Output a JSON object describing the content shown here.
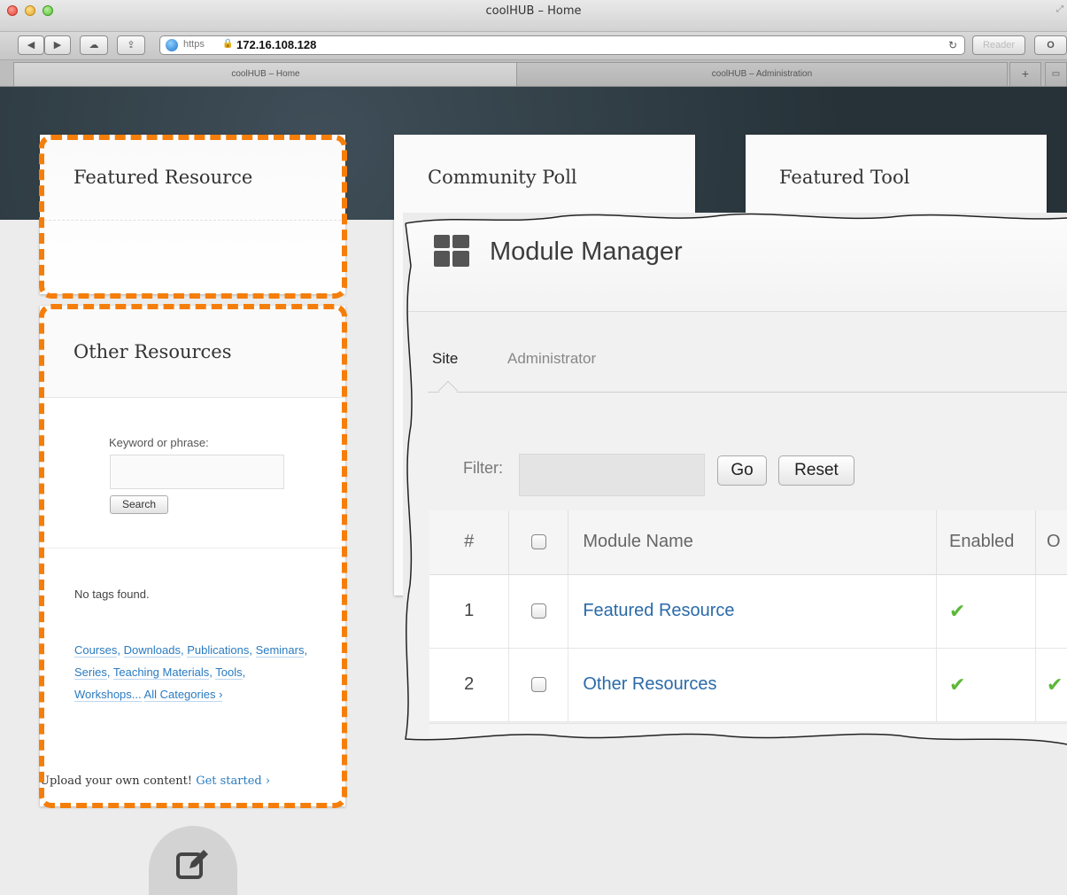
{
  "browser": {
    "window_title": "coolHUB – Home",
    "url_scheme": "https",
    "url_host": "172.16.108.128",
    "reader_label": "Reader",
    "extra_button_label": "O",
    "tabs": [
      {
        "label": "coolHUB – Home"
      },
      {
        "label": "coolHUB – Administration"
      }
    ],
    "new_tab_label": "+"
  },
  "hub": {
    "featured_resource_title": "Featured Resource",
    "community_poll_title": "Community Poll",
    "featured_tool_title": "Featured Tool",
    "other_resources": {
      "title": "Other Resources",
      "keyword_label": "Keyword or phrase:",
      "search_button": "Search",
      "no_tags": "No tags found.",
      "categories": [
        "Courses",
        "Downloads",
        "Publications",
        "Seminars",
        "Series",
        "Teaching Materials",
        "Tools",
        "Workshops..."
      ],
      "all_categories": "All Categories ›",
      "upload_text": "Upload your own content!",
      "get_started": "Get started ›"
    }
  },
  "module_manager": {
    "title": "Module Manager",
    "tabs": [
      {
        "label": "Site",
        "active": true
      },
      {
        "label": "Administrator",
        "active": false
      }
    ],
    "filter_label": "Filter:",
    "filter_value": "",
    "go_button": "Go",
    "reset_button": "Reset",
    "columns": [
      "#",
      "",
      "Module Name",
      "Enabled",
      "O"
    ],
    "rows": [
      {
        "num": "1",
        "name": "Featured Resource",
        "enabled": true
      },
      {
        "num": "2",
        "name": "Other Resources",
        "enabled": true
      }
    ]
  },
  "colors": {
    "highlight": "#f57e0a",
    "link": "#2a7bc0",
    "check": "#5cb837"
  },
  "icons": [
    "globe-icon",
    "lock-icon",
    "reload-icon",
    "grid-icon",
    "compose-icon",
    "checkmark-icon"
  ]
}
